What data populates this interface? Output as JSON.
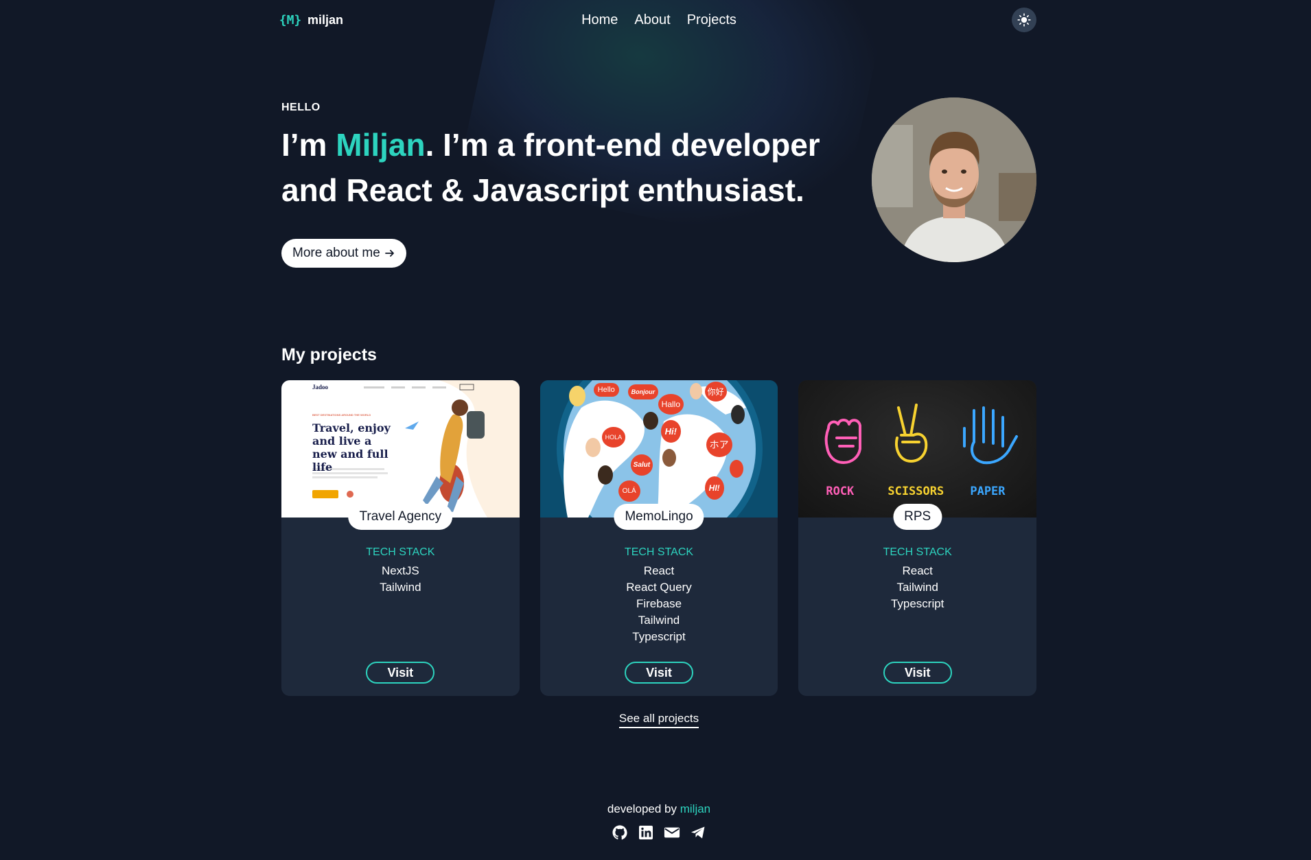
{
  "nav": {
    "logo_mark": "{M}",
    "brand": "miljan",
    "links": [
      "Home",
      "About",
      "Projects"
    ],
    "theme_icon": "sun-icon"
  },
  "hero": {
    "eyebrow": "HELLO",
    "headline_prefix": "I’m ",
    "headline_name": "Miljan",
    "headline_rest": ". I’m a front-end developer and React & Javascript enthusiast.",
    "button_label": "More about me",
    "button_icon": "arrow-right-icon"
  },
  "projects": {
    "title": "My projects",
    "tech_heading": "TECH STACK",
    "visit_label": "Visit",
    "items": [
      {
        "name": "Travel Agency",
        "stack": [
          "NextJS",
          "Tailwind"
        ],
        "preview": {
          "brand": "Jadoo",
          "tagline": "BEST DESTINATIONS AROUND THE WORLD",
          "heading": "Travel, enjoy and live a new and full life"
        }
      },
      {
        "name": "MemoLingo",
        "stack": [
          "React",
          "React Query",
          "Firebase",
          "Tailwind",
          "Typescript"
        ],
        "preview": {
          "bubbles": [
            "Hello",
            "Bonjour",
            "Hallo",
            "你好",
            "HOLA",
            "Hi!",
            "ホア",
            "Salut",
            "OLÁ",
            "HI!"
          ]
        }
      },
      {
        "name": "RPS",
        "stack": [
          "React",
          "Tailwind",
          "Typescript"
        ],
        "preview": {
          "labels": [
            "ROCK",
            "SCISSORS",
            "PAPER"
          ]
        }
      }
    ],
    "see_all": "See all projects"
  },
  "footer": {
    "prefix": "developed by ",
    "name": "miljan",
    "socials": [
      "github-icon",
      "linkedin-icon",
      "mail-icon",
      "telegram-icon"
    ]
  },
  "colors": {
    "background": "#111827",
    "card": "#1e293b",
    "accent": "#2dd4bf"
  }
}
